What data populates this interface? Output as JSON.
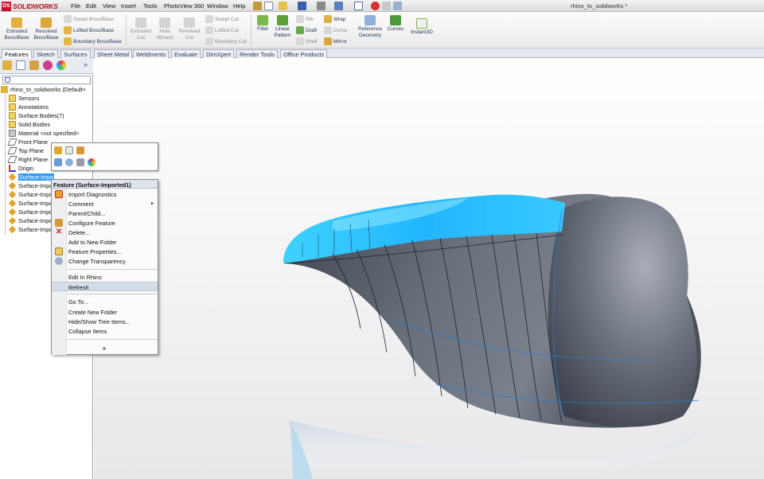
{
  "app": {
    "logo_text": "SOLIDWORKS",
    "logo_mark": "DS",
    "document_title": "rhino_to_solidworks *"
  },
  "menubar": {
    "items": [
      "File",
      "Edit",
      "View",
      "Insert",
      "Tools",
      "PhotoView 360",
      "Window",
      "Help"
    ]
  },
  "commands": {
    "extruded_boss": "Extruded\nBoss/Base",
    "revolved_boss": "Revolved\nBoss/Base",
    "swept_boss": "Swept Boss/Base",
    "lofted_boss": "Lofted Boss/Base",
    "boundary_boss": "Boundary Boss/Base",
    "extruded_cut": "Extruded\nCut",
    "hole_wizard": "Hole\nWizard",
    "revolved_cut": "Revolved\nCut",
    "swept_cut": "Swept Cut",
    "lofted_cut": "Lofted Cut",
    "boundary_cut": "Boundary Cut",
    "fillet": "Fillet",
    "linear_pattern": "Linear\nPattern",
    "rib": "Rib",
    "draft": "Draft",
    "shell": "Shell",
    "wrap": "Wrap",
    "dome": "Dome",
    "mirror": "Mirror",
    "reference_geometry": "Reference\nGeometry",
    "curves": "Curves",
    "instant3d": "Instant3D"
  },
  "tabs": [
    "Features",
    "Sketch",
    "Surfaces",
    "Sheet Metal",
    "Weldments",
    "Evaluate",
    "DimXpert",
    "Render Tools",
    "Office Products"
  ],
  "active_tab": "Features",
  "tree": {
    "root": "rhino_to_solidworks  (Default<",
    "items": [
      "Sensors",
      "Annotations",
      "Surface Bodies(7)",
      "Solid Bodies",
      "Material <not specified>",
      "Front Plane",
      "Top Plane",
      "Right Plane",
      "Origin",
      "Surface-Impo",
      "Surface-Impo",
      "Surface-Impo",
      "Surface-Impo",
      "Surface-Impo",
      "Surface-Impo",
      "Surface-Impo"
    ]
  },
  "context_menu": {
    "title": "Feature (Surface-Imported1)",
    "items": [
      "Import Diagnostics",
      "Comment",
      "Parent/Child...",
      "Configure Feature",
      "Delete...",
      "Add to New Folder",
      "Feature Properties...",
      "Change Transparency",
      "Edit In Rhino",
      "Refresh",
      "Go To...",
      "Create New Folder",
      "Hide/Show Tree Items...",
      "Collapse Items",
      "»"
    ]
  },
  "colors": {
    "accent": "#3399ff",
    "model_body": "#5c626e",
    "model_highlight": "#29c4ff",
    "logo_red": "#c8102e"
  }
}
